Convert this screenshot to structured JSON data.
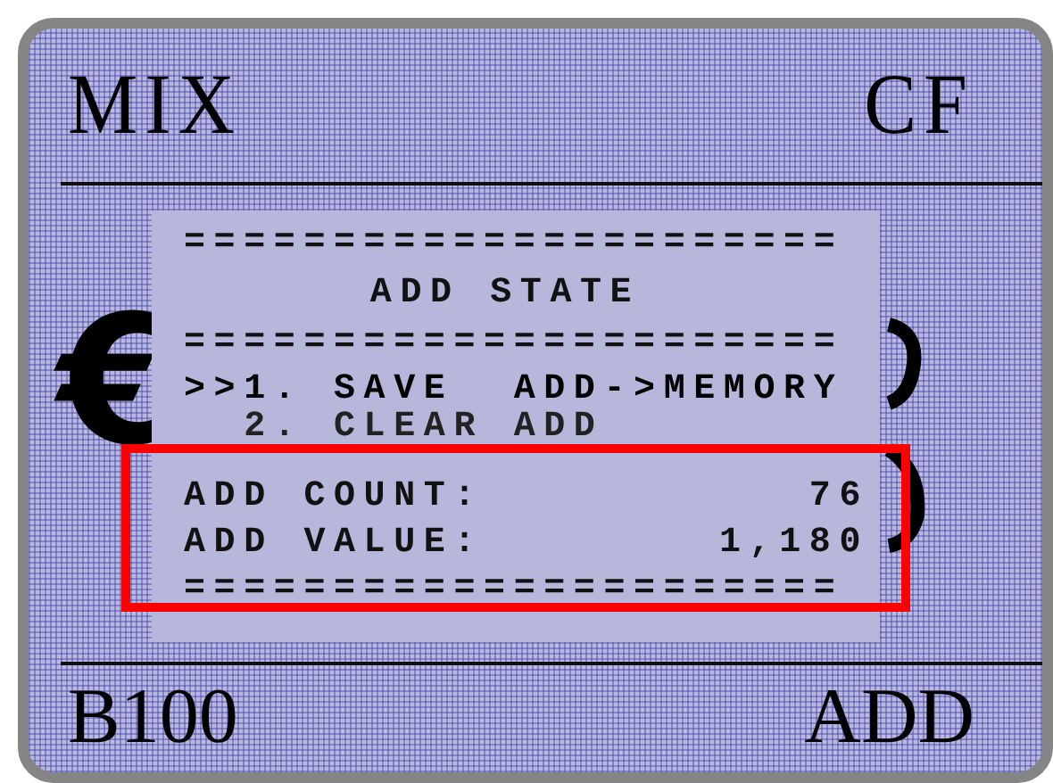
{
  "header": {
    "mode": "MIX",
    "function": "CF"
  },
  "background": {
    "currency_symbol": "€"
  },
  "dialog": {
    "rule_top": "======================",
    "title": "ADD STATE",
    "rule_mid": "======================",
    "cursor": ">>",
    "options": [
      {
        "number": "1.",
        "label": "SAVE  ADD->MEMORY",
        "selected": true
      },
      {
        "number": "2.",
        "label": "CLEAR ADD",
        "selected": false
      }
    ],
    "fields": [
      {
        "label": "ADD COUNT:",
        "value": "76"
      },
      {
        "label": "ADD VALUE:",
        "value": "1,180"
      }
    ],
    "rule_bottom": "======================"
  },
  "footer": {
    "denomination": "B100",
    "mode": "ADD"
  }
}
